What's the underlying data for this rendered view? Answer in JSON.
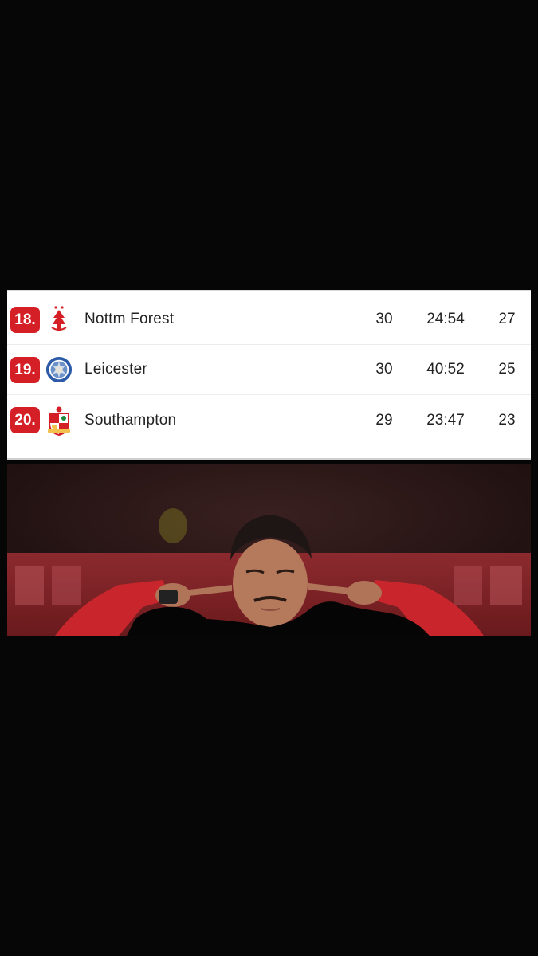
{
  "standings": {
    "rows": [
      {
        "rank": "18.",
        "team": "Nottm Forest",
        "played": "30",
        "goals": "24:54",
        "points": "27",
        "crest": "nottingham-forest-crest-icon"
      },
      {
        "rank": "19.",
        "team": "Leicester",
        "played": "30",
        "goals": "40:52",
        "points": "25",
        "crest": "leicester-crest-icon"
      },
      {
        "rank": "20.",
        "team": "Southampton",
        "played": "29",
        "goals": "23:47",
        "points": "23",
        "crest": "southampton-crest-icon"
      }
    ]
  },
  "colors": {
    "rank_badge": "#d41f26",
    "background": "#060606",
    "card": "#ffffff"
  },
  "photo": {
    "subject": "player-covering-ears-photo"
  }
}
